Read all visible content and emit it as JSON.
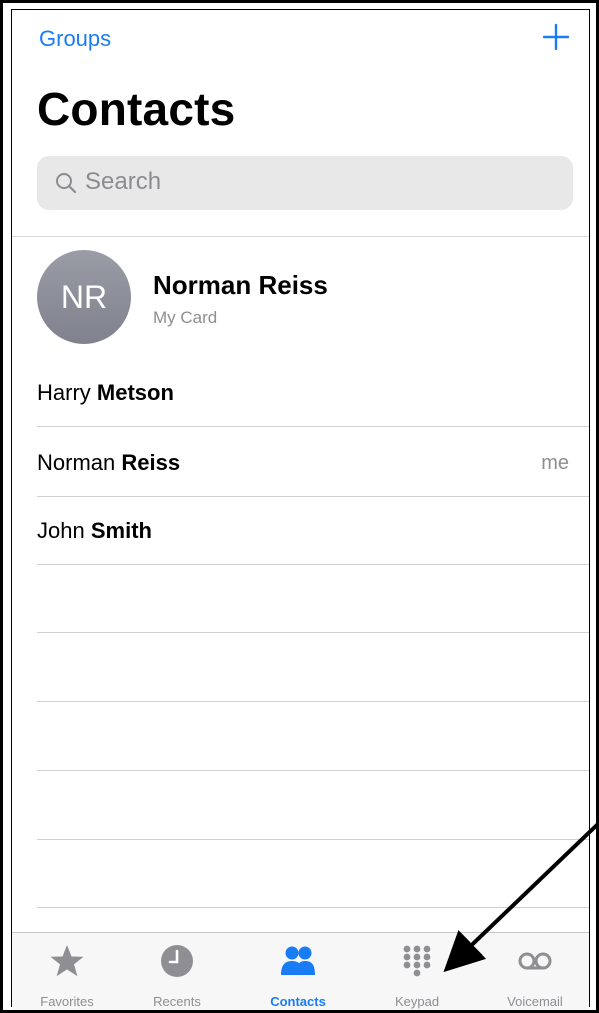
{
  "colors": {
    "accent": "#1a7cf5",
    "inactive": "#8e8e93",
    "search_bg": "#e8e8e9",
    "avatar": "#8b8e99"
  },
  "header": {
    "groups_label": "Groups",
    "add_icon": "plus-icon",
    "title": "Contacts"
  },
  "search": {
    "icon": "search-icon",
    "placeholder": "Search"
  },
  "my_card": {
    "initials": "NR",
    "name": "Norman Reiss",
    "subtitle": "My Card"
  },
  "contacts": [
    {
      "first": "Harry",
      "last": "Metson",
      "tag": ""
    },
    {
      "first": "Norman",
      "last": "Reiss",
      "tag": "me"
    },
    {
      "first": "John",
      "last": "Smith",
      "tag": ""
    }
  ],
  "tab_bar": {
    "active": "Contacts",
    "tabs": [
      {
        "label": "Favorites",
        "icon": "star-icon"
      },
      {
        "label": "Recents",
        "icon": "clock-icon"
      },
      {
        "label": "Contacts",
        "icon": "contacts-icon"
      },
      {
        "label": "Keypad",
        "icon": "keypad-icon"
      },
      {
        "label": "Voicemail",
        "icon": "voicemail-icon"
      }
    ]
  },
  "annotation": {
    "icon": "pointer-arrow",
    "points_to": "Keypad"
  }
}
